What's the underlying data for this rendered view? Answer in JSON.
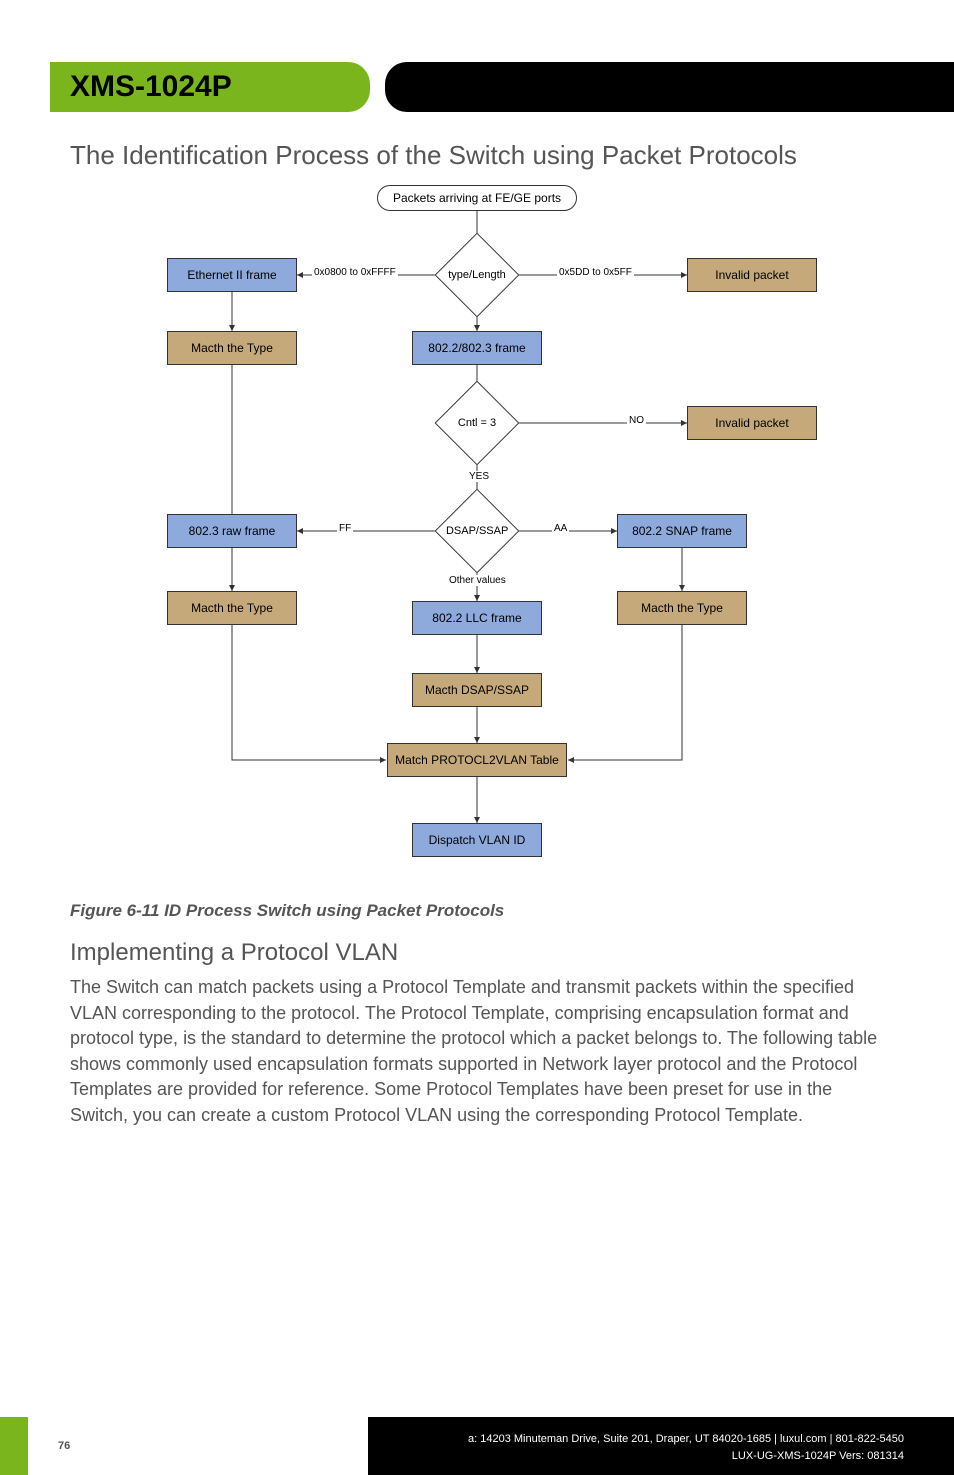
{
  "header": {
    "product": "XMS-1024P"
  },
  "section_title": "The Identification Process of the Switch using Packet Protocols",
  "figure_caption": "Figure 6-11 ID Process Switch using Packet Protocols",
  "subsection_title": "Implementing a Protocol VLAN",
  "body_text": "The Switch can match packets using a Protocol Template and transmit packets within the specified VLAN corresponding to the protocol. The Protocol Template, comprising encapsulation format and protocol type, is the standard to determine the protocol which a packet belongs to. The following table shows commonly used encapsulation formats supported in Network layer protocol and the Protocol Templates are provided for reference. Some Protocol Templates have been preset for use in the Switch, you can create a custom Protocol VLAN using the corresponding Protocol Template.",
  "footer": {
    "page_number": "76",
    "address": "a: 14203 Minuteman Drive, Suite 201, Draper, UT 84020-1685 | luxul.com | 801-822-5450",
    "docline": "LUX-UG-XMS-1024P  Vers: 081314"
  },
  "chart_data": {
    "type": "flowchart",
    "title": "The Identification Process of the Switch using Packet Protocols",
    "nodes": [
      {
        "id": "start",
        "type": "start",
        "label": "Packets arriving at FE/GE ports"
      },
      {
        "id": "type_length",
        "type": "decision",
        "label": "type/Length"
      },
      {
        "id": "ethernet_ii",
        "type": "process-blue",
        "label": "Ethernet II frame"
      },
      {
        "id": "invalid1",
        "type": "process-tan",
        "label": "Invalid packet"
      },
      {
        "id": "match_type1",
        "type": "process-tan",
        "label": "Macth the Type"
      },
      {
        "id": "frame_8023",
        "type": "process-blue",
        "label": "802.2/802.3 frame"
      },
      {
        "id": "cntl3",
        "type": "decision",
        "label": "Cntl = 3"
      },
      {
        "id": "invalid2",
        "type": "process-tan",
        "label": "Invalid packet"
      },
      {
        "id": "dsap_ssap",
        "type": "decision",
        "label": "DSAP/SSAP"
      },
      {
        "id": "raw_8023",
        "type": "process-blue",
        "label": "802.3 raw frame"
      },
      {
        "id": "snap_8022",
        "type": "process-blue",
        "label": "802.2 SNAP frame"
      },
      {
        "id": "match_type2",
        "type": "process-tan",
        "label": "Macth the Type"
      },
      {
        "id": "match_type3",
        "type": "process-tan",
        "label": "Macth the Type"
      },
      {
        "id": "llc_8022",
        "type": "process-blue",
        "label": "802.2 LLC frame"
      },
      {
        "id": "match_dsap",
        "type": "process-tan",
        "label": "Macth DSAP/SSAP"
      },
      {
        "id": "match_table",
        "type": "process-tan",
        "label": "Match PROTOCL2VLAN Table"
      },
      {
        "id": "dispatch",
        "type": "process-blue",
        "label": "Dispatch VLAN ID"
      }
    ],
    "edges": [
      {
        "from": "start",
        "to": "type_length",
        "label": ""
      },
      {
        "from": "type_length",
        "to": "ethernet_ii",
        "label": "0x0800 to 0xFFFF"
      },
      {
        "from": "type_length",
        "to": "invalid1",
        "label": "0x5DD to 0x5FF"
      },
      {
        "from": "type_length",
        "to": "frame_8023",
        "label": ""
      },
      {
        "from": "ethernet_ii",
        "to": "match_type1",
        "label": ""
      },
      {
        "from": "frame_8023",
        "to": "cntl3",
        "label": ""
      },
      {
        "from": "cntl3",
        "to": "invalid2",
        "label": "NO"
      },
      {
        "from": "cntl3",
        "to": "dsap_ssap",
        "label": "YES"
      },
      {
        "from": "dsap_ssap",
        "to": "raw_8023",
        "label": "FF"
      },
      {
        "from": "dsap_ssap",
        "to": "snap_8022",
        "label": "AA"
      },
      {
        "from": "dsap_ssap",
        "to": "llc_8022",
        "label": "Other values"
      },
      {
        "from": "raw_8023",
        "to": "match_type2",
        "label": ""
      },
      {
        "from": "snap_8022",
        "to": "match_type3",
        "label": ""
      },
      {
        "from": "llc_8022",
        "to": "match_dsap",
        "label": ""
      },
      {
        "from": "match_type1",
        "to": "match_table",
        "label": ""
      },
      {
        "from": "match_type2",
        "to": "match_table",
        "label": ""
      },
      {
        "from": "match_type3",
        "to": "match_table",
        "label": ""
      },
      {
        "from": "match_dsap",
        "to": "match_table",
        "label": ""
      },
      {
        "from": "match_table",
        "to": "dispatch",
        "label": ""
      }
    ],
    "edge_labels": {
      "type_length_left": "0x0800 to 0xFFFF",
      "type_length_right": "0x5DD to 0x5FF",
      "cntl3_no": "NO",
      "cntl3_yes": "YES",
      "dsap_ff": "FF",
      "dsap_aa": "AA",
      "dsap_other": "Other values"
    }
  }
}
